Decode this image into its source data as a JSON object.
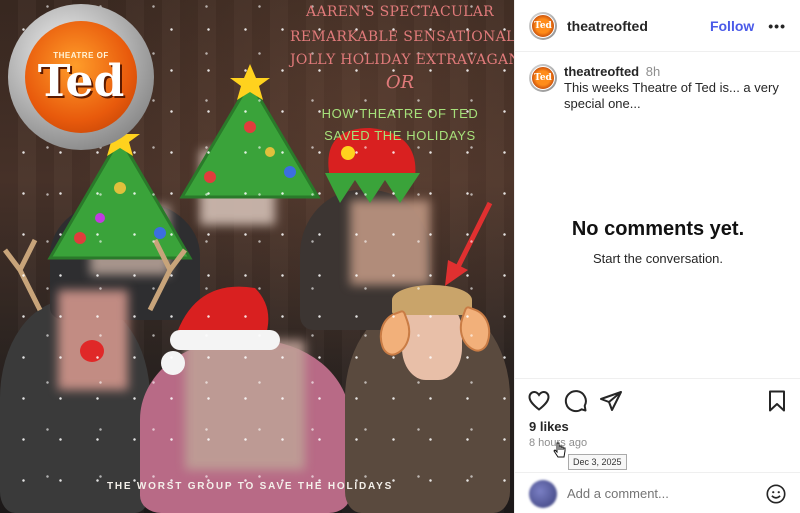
{
  "post_image": {
    "title_lines": [
      "AAREN'S SPECTACULAR",
      "REMARKABLE SENSATIONAL",
      "JOLLY HOLIDAY EXTRAVAGANZA"
    ],
    "or_text": "OR",
    "subtitle_lines": [
      "HOW THEATRE OF TED",
      "SAVED THE HOLIDAYS"
    ],
    "bottom_caption": "THE WORST GROUP TO SAVE THE HOLIDAYS",
    "logo_small": "THEATRE OF",
    "logo_big": "Ted"
  },
  "header": {
    "username": "theatreofted",
    "follow_label": "Follow",
    "more_label": "•••"
  },
  "caption": {
    "username": "theatreofted",
    "time": "8h",
    "text": "This weeks Theatre of Ted is... a very special one..."
  },
  "comments": {
    "empty_title": "No comments yet.",
    "empty_subtitle": "Start the conversation."
  },
  "engagement": {
    "likes": "9 likes",
    "time_ago": "8 hours ago",
    "tooltip": "Dec 3, 2025"
  },
  "comment_input": {
    "placeholder": "Add a comment..."
  },
  "icons": {
    "like": "heart-icon",
    "comment": "comment-icon",
    "share": "paper-plane-icon",
    "save": "bookmark-icon",
    "emoji": "smiley-icon"
  },
  "colors": {
    "follow": "#4a5ae8",
    "title_red": "#e07a7a",
    "subtitle_green": "#a6e07a"
  }
}
